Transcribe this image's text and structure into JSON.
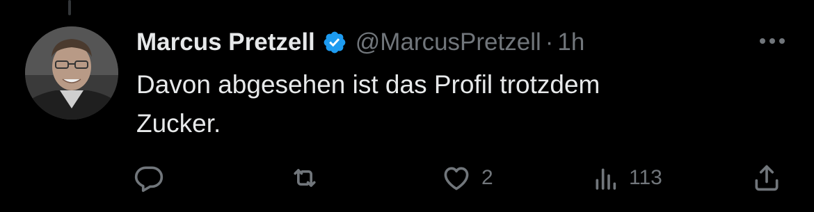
{
  "tweet": {
    "display_name": "Marcus Pretzell",
    "handle": "@MarcusPretzell",
    "separator": "·",
    "time": "1h",
    "text_lines": [
      "Davon abgesehen ist das Profil trotzdem",
      "Zucker."
    ],
    "verified": true
  },
  "actions": {
    "reply": {
      "icon": "reply-icon",
      "count": ""
    },
    "retweet": {
      "icon": "retweet-icon",
      "count": ""
    },
    "like": {
      "icon": "heart-icon",
      "count": "2"
    },
    "views": {
      "icon": "views-icon",
      "count": "113"
    },
    "share": {
      "icon": "share-icon",
      "count": ""
    }
  },
  "colors": {
    "background": "#000000",
    "text": "#e7e9ea",
    "muted": "#71767b",
    "verified_blue": "#1d9bf0"
  }
}
